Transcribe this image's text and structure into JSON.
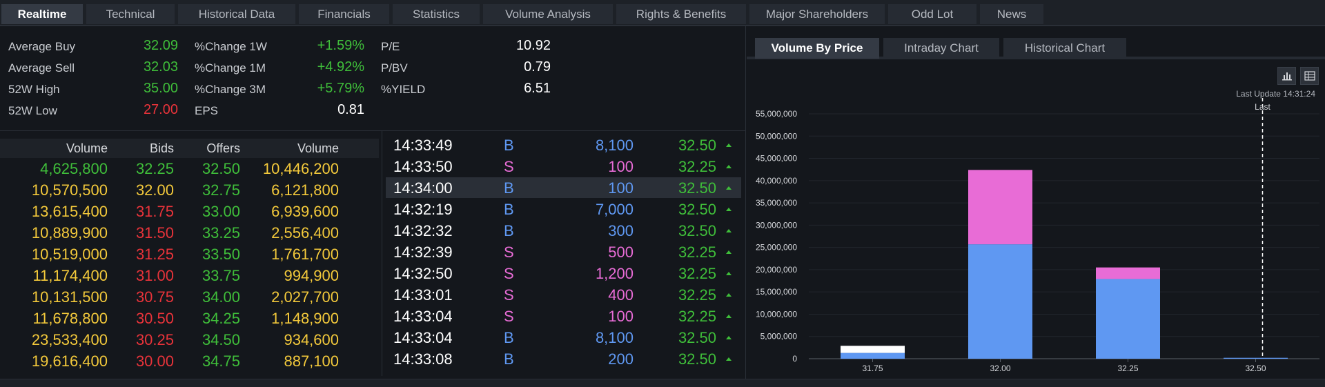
{
  "top_tabs": [
    {
      "label": "Realtime",
      "active": true
    },
    {
      "label": "Technical"
    },
    {
      "label": "Historical Data"
    },
    {
      "label": "Financials"
    },
    {
      "label": "Statistics"
    },
    {
      "label": "Volume Analysis"
    },
    {
      "label": "Rights & Benefits"
    },
    {
      "label": "Major Shareholders"
    },
    {
      "label": "Odd Lot"
    },
    {
      "label": "News"
    }
  ],
  "stats": {
    "avg_buy": {
      "label": "Average Buy",
      "value": "32.09"
    },
    "avg_sell": {
      "label": "Average Sell",
      "value": "32.03"
    },
    "high_52w": {
      "label": "52W High",
      "value": "35.00"
    },
    "low_52w": {
      "label": "52W Low",
      "value": "27.00"
    },
    "chg_1w": {
      "label": "%Change 1W",
      "value": "+1.59%"
    },
    "chg_1m": {
      "label": "%Change 1M",
      "value": "+4.92%"
    },
    "chg_3m": {
      "label": "%Change 3M",
      "value": "+5.79%"
    },
    "eps": {
      "label": "EPS",
      "value": "0.81"
    },
    "pe": {
      "label": "P/E",
      "value": "10.92"
    },
    "pbv": {
      "label": "P/BV",
      "value": "0.79"
    },
    "yield": {
      "label": "%YIELD",
      "value": "6.51"
    }
  },
  "order_book": {
    "headers": [
      "Volume",
      "Bids",
      "Offers",
      "Volume"
    ],
    "rows": [
      [
        "4,625,800",
        "32.25",
        "32.50",
        "10,446,200"
      ],
      [
        "10,570,500",
        "32.00",
        "32.75",
        "6,121,800"
      ],
      [
        "13,615,400",
        "31.75",
        "33.00",
        "6,939,600"
      ],
      [
        "10,889,900",
        "31.50",
        "33.25",
        "2,556,400"
      ],
      [
        "10,519,000",
        "31.25",
        "33.50",
        "1,761,700"
      ],
      [
        "11,174,400",
        "31.00",
        "33.75",
        "994,900"
      ],
      [
        "10,131,500",
        "30.75",
        "34.00",
        "2,027,700"
      ],
      [
        "11,678,800",
        "30.50",
        "34.25",
        "1,148,900"
      ],
      [
        "23,533,400",
        "30.25",
        "34.50",
        "934,600"
      ],
      [
        "19,616,400",
        "30.00",
        "34.75",
        "887,100"
      ]
    ]
  },
  "trades": [
    {
      "time": "14:33:49",
      "side": "B",
      "vol": "8,100",
      "price": "32.50"
    },
    {
      "time": "14:33:50",
      "side": "S",
      "vol": "100",
      "price": "32.25"
    },
    {
      "time": "14:34:00",
      "side": "B",
      "vol": "100",
      "price": "32.50"
    },
    {
      "time": "14:32:19",
      "side": "B",
      "vol": "7,000",
      "price": "32.50"
    },
    {
      "time": "14:32:32",
      "side": "B",
      "vol": "300",
      "price": "32.50"
    },
    {
      "time": "14:32:39",
      "side": "S",
      "vol": "500",
      "price": "32.25"
    },
    {
      "time": "14:32:50",
      "side": "S",
      "vol": "1,200",
      "price": "32.25"
    },
    {
      "time": "14:33:01",
      "side": "S",
      "vol": "400",
      "price": "32.25"
    },
    {
      "time": "14:33:04",
      "side": "S",
      "vol": "100",
      "price": "32.25"
    },
    {
      "time": "14:33:04",
      "side": "B",
      "vol": "8,100",
      "price": "32.50"
    },
    {
      "time": "14:33:08",
      "side": "B",
      "vol": "200",
      "price": "32.50"
    }
  ],
  "sub_tabs": [
    {
      "label": "Volume By Price",
      "active": true
    },
    {
      "label": "Intraday Chart"
    },
    {
      "label": "Historical Chart"
    }
  ],
  "last_update": "Last Update 14:31:24",
  "colors": {
    "buy": "#5f98f2",
    "sell": "#e86cd6",
    "up": "#3fbe3a",
    "down": "#e8333a",
    "neutral": "#f3c93b",
    "unknown": "#ffffff"
  },
  "chart_data": {
    "type": "bar",
    "stacked": true,
    "categories": [
      "31.75",
      "32.00",
      "32.25",
      "32.50"
    ],
    "series": [
      {
        "name": "",
        "color": "#5f98f2",
        "values": [
          1300000,
          25700000,
          17900000,
          200000
        ]
      },
      {
        "name": "",
        "color": "#ffffff",
        "values": [
          1600000,
          0,
          0,
          0
        ]
      },
      {
        "name": "",
        "color": "#e86cd6",
        "values": [
          0,
          16700000,
          2600000,
          0
        ]
      }
    ],
    "ylim": [
      0,
      55000000
    ],
    "yticks": [
      0,
      5000000,
      10000000,
      15000000,
      20000000,
      25000000,
      30000000,
      35000000,
      40000000,
      45000000,
      50000000,
      55000000
    ],
    "ytick_labels": [
      "0",
      "5,000,000",
      "10,000,000",
      "15,000,000",
      "20,000,000",
      "25,000,000",
      "30,000,000",
      "35,000,000",
      "40,000,000",
      "45,000,000",
      "50,000,000",
      "55,000,000"
    ],
    "marker": {
      "category": "32.50",
      "label": "Last"
    },
    "grid": true
  }
}
